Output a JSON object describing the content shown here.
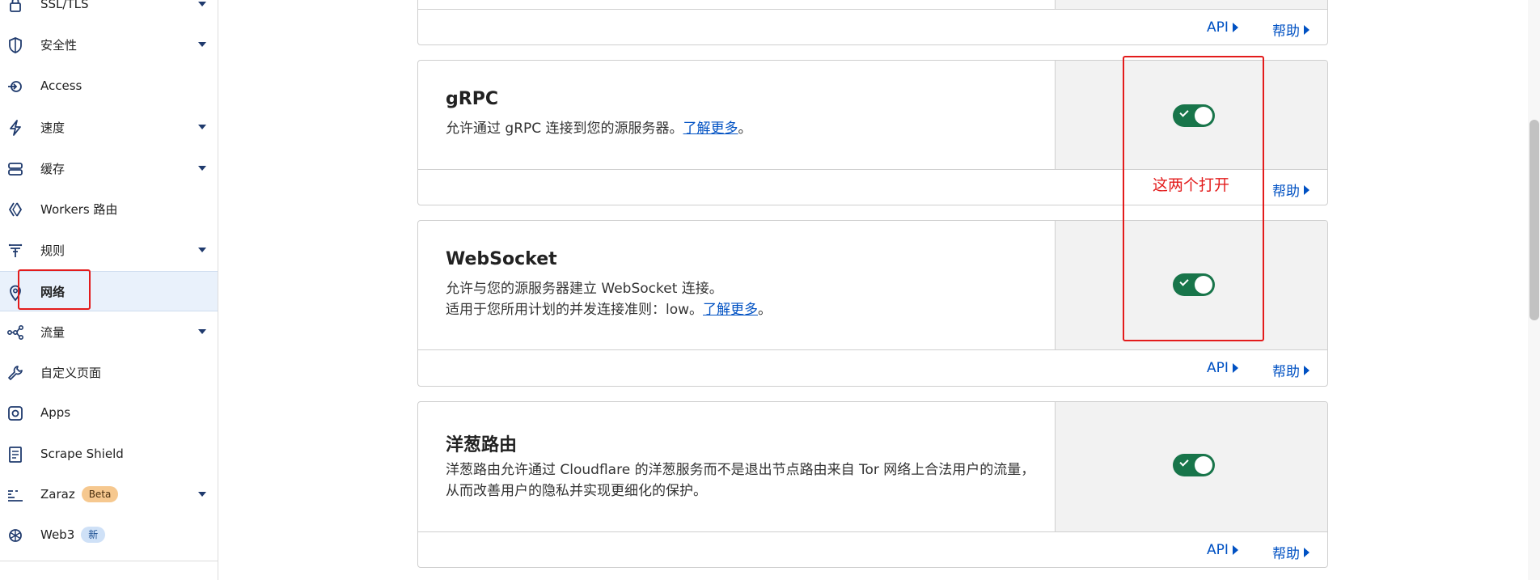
{
  "sidebar": {
    "items": [
      {
        "label": "SSL/TLS",
        "icon": "lock-icon",
        "caret": true
      },
      {
        "label": "安全性",
        "icon": "shield-icon",
        "caret": true
      },
      {
        "label": "Access",
        "icon": "access-icon",
        "caret": false
      },
      {
        "label": "速度",
        "icon": "lightning-icon",
        "caret": true
      },
      {
        "label": "缓存",
        "icon": "storage-icon",
        "caret": true
      },
      {
        "label": "Workers 路由",
        "icon": "workers-icon",
        "caret": false
      },
      {
        "label": "规则",
        "icon": "funnel-icon",
        "caret": true
      },
      {
        "label": "网络",
        "icon": "location-pin-icon",
        "caret": false,
        "active": true
      },
      {
        "label": "流量",
        "icon": "network-nodes-icon",
        "caret": true
      },
      {
        "label": "自定义页面",
        "icon": "wrench-icon",
        "caret": false
      },
      {
        "label": "Apps",
        "icon": "apps-icon",
        "caret": false
      },
      {
        "label": "Scrape Shield",
        "icon": "document-icon",
        "caret": false
      },
      {
        "label": "Zaraz",
        "icon": "zaraz-icon",
        "caret": true,
        "badge": "Beta"
      },
      {
        "label": "Web3",
        "icon": "web3-icon",
        "caret": false,
        "badge": "新"
      }
    ]
  },
  "cards": [
    {
      "id": "grpc",
      "title": "gRPC",
      "lines": [
        "允许通过 gRPC 连接到您的源服务器。"
      ],
      "link": "了解更多",
      "enabled": true,
      "footer": {
        "help": "帮助"
      }
    },
    {
      "id": "websocket",
      "title": "WebSocket",
      "lines": [
        "允许与您的源服务器建立 WebSocket 连接。",
        "适用于您所用计划的并发连接准则：low。"
      ],
      "link": "了解更多",
      "enabled": true,
      "footer": {
        "api": "API",
        "help": "帮助"
      }
    },
    {
      "id": "onion",
      "title": "洋葱路由",
      "lines": [
        "洋葱路由允许通过 Cloudflare 的洋葱服务而不是退出节点路由来自 Tor 网络上合法用户的流量，从而改善用户的隐私并实现更细化的保护。"
      ],
      "enabled": true,
      "footer": {
        "api": "API",
        "help": "帮助"
      }
    }
  ],
  "top_card_footer": {
    "api": "API",
    "help": "帮助"
  },
  "annotation": {
    "text": "这两个打开",
    "color": "#e31b1b"
  },
  "colors": {
    "accent": "#0051c3",
    "toggle_on": "#18754a",
    "annotation": "#e31b1b"
  }
}
